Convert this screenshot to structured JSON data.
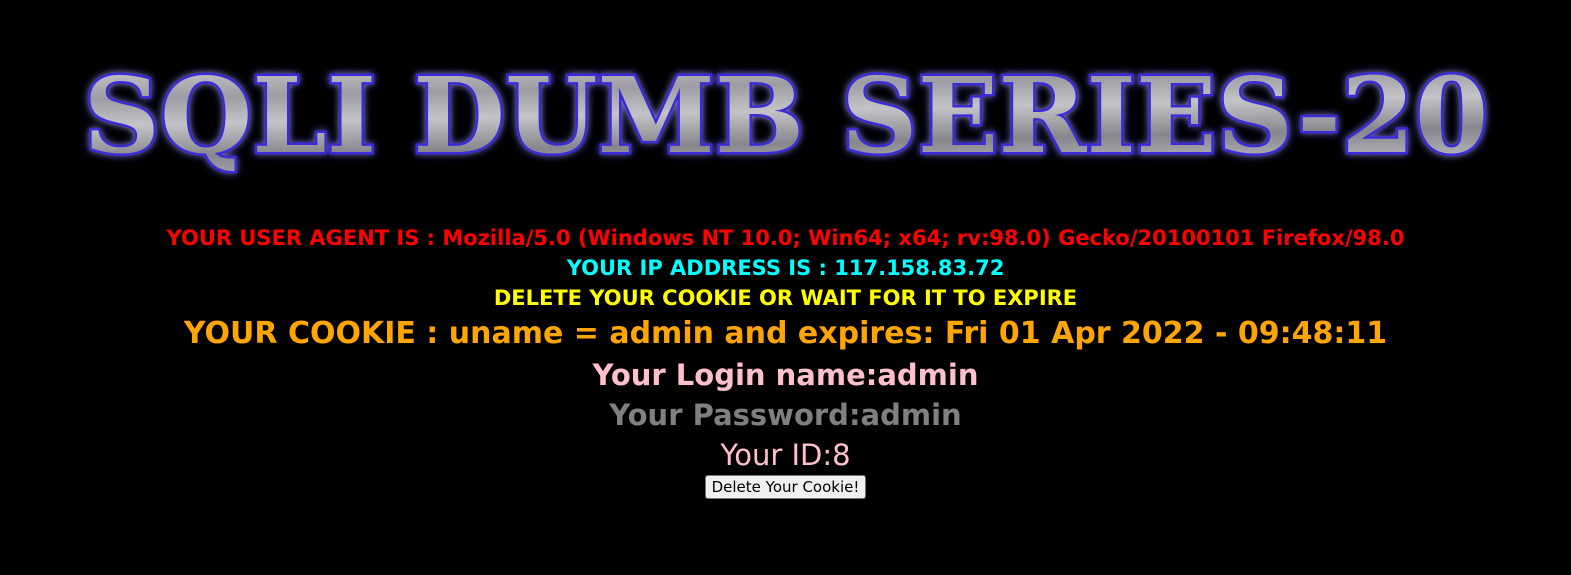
{
  "banner": {
    "title": "SQLI DUMB SERIES-20"
  },
  "info": {
    "user_agent": "YOUR USER AGENT IS : Mozilla/5.0 (Windows NT 10.0; Win64; x64; rv:98.0) Gecko/20100101 Firefox/98.0",
    "ip_address": "YOUR IP ADDRESS IS : 117.158.83.72",
    "delete_notice": "DELETE YOUR COOKIE OR WAIT FOR IT TO EXPIRE",
    "cookie": "YOUR COOKIE : uname = admin and expires: Fri 01 Apr 2022 - 09:48:11",
    "login_name": "Your Login name:admin",
    "password": "Your Password:admin",
    "id": "Your ID:8"
  },
  "form": {
    "delete_button_label": "Delete Your Cookie!"
  },
  "colors": {
    "background": "#000000",
    "user_agent": "#ff0000",
    "ip_address": "#00ffff",
    "delete_notice": "#ffff00",
    "cookie": "#ffa500",
    "login_name": "#ffc0cb",
    "password": "#808080",
    "id": "#ffc0cb"
  }
}
